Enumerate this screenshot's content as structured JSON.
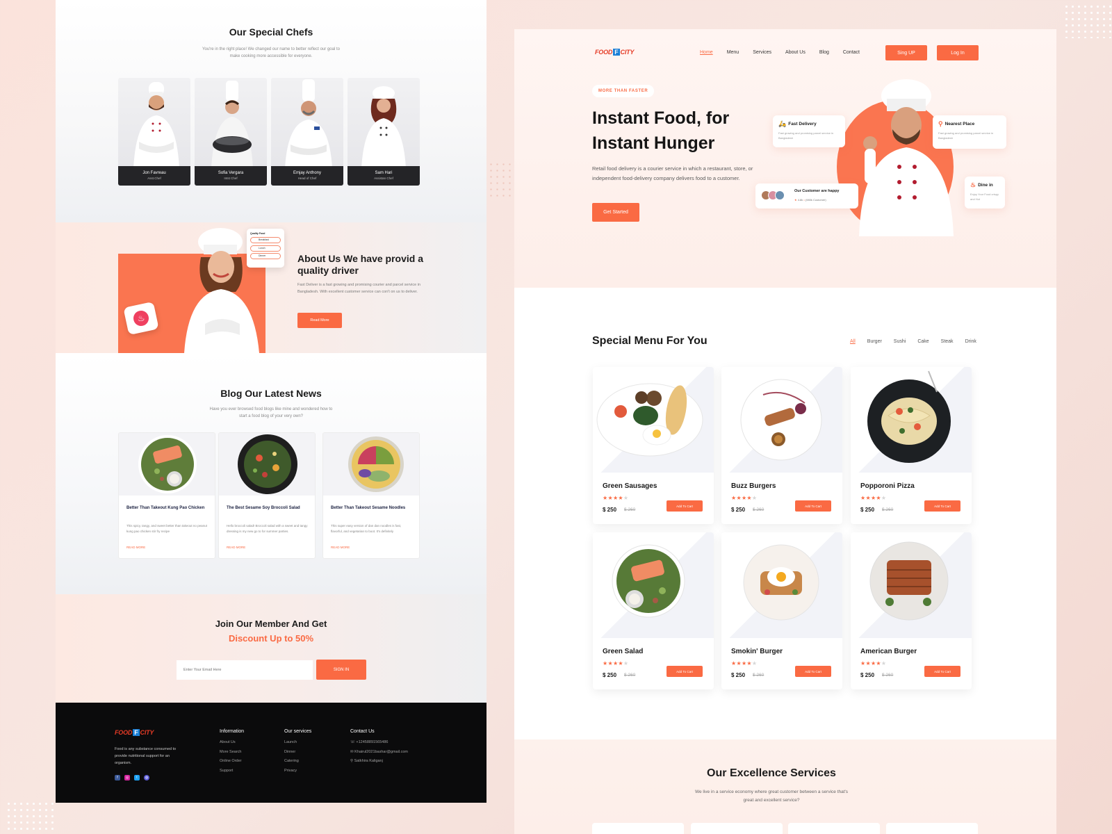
{
  "colors": {
    "accent": "#fa6a43",
    "accent_soft": "#fde9e2",
    "dark": "#0b0b0c"
  },
  "chefs": {
    "title": "Our Special Chefs",
    "subtitle": "You're in the right place! We changed our name to better reflect our goal to make cooking more accessible for everyone.",
    "items": [
      {
        "name": "Jon Favreau",
        "role": "Asst.Chef"
      },
      {
        "name": "Sofia Vergara",
        "role": "Intst Chef"
      },
      {
        "name": "Emjay Anthony",
        "role": "Head of Chef"
      },
      {
        "name": "Sam Hari",
        "role": "Assistan Chef"
      }
    ]
  },
  "about": {
    "title": "About Us We have provid a quality driver",
    "text": "Fast Deliver is a fast growing and promising courier and parcel service in Bangladesh. With excellent customer service can con't on us to deliver.",
    "button": "Read More",
    "quality_card": {
      "title": "Quality Food",
      "items": [
        "Breakfast",
        "Lunch",
        "Dinner"
      ]
    }
  },
  "blog": {
    "title": "Blog Our Latest News",
    "subtitle": "Have you ever browsed food blogs like mine and wondered how to start a food blog of your very own?",
    "posts": [
      {
        "title": "Better Than Takeout Kung Pao Chicken",
        "text": "This spicy, tangy, and sweet better than takeout no peanut kung pao chicken stir fry recipe",
        "more": "READ MORE"
      },
      {
        "title": "The Best Sesame Soy Broccoli Salad",
        "text": "Hello broccoli salad! Broccoli salad with a sweet and tangy dressing is my new go to for summer parties.",
        "more": "READ MORE"
      },
      {
        "title": "Better Than Takeout Sesame Noodles",
        "text": "This super easy version of dan dan noodles is fast, flavorful, and vegetarian to boot. It's definitely",
        "more": "READ MORE"
      }
    ]
  },
  "join": {
    "line1": "Join Our  Member And Get",
    "line2": "Discount Up to 50%",
    "placeholder": "Enter Your Email Here",
    "button": "SIGN IN"
  },
  "footer": {
    "logo_a": "FOOD",
    "logo_b": "F",
    "logo_c": "CITY",
    "about": "Food is any substance consumed to provide nutritional support for an organism.",
    "columns": [
      {
        "title": "Information",
        "links": [
          "About Us",
          "More Search",
          "Online Order",
          "Support"
        ]
      },
      {
        "title": "Our services",
        "links": [
          "Launch",
          "Dinner",
          "Catering",
          "Privacy"
        ]
      },
      {
        "title": "Contact Us",
        "links": [
          "+12458891565486",
          "Khairul2021bashar@gmail.com",
          "Satkhira Kaliganj"
        ]
      }
    ]
  },
  "nav": {
    "items": [
      "Home",
      "Menu",
      "Services",
      "About Us",
      "Blog",
      "Contact"
    ],
    "signup": "Sing UP",
    "login": "Log In"
  },
  "hero": {
    "pill": "MORE THAN FASTER",
    "title_line1": "Instant Food, for",
    "title_line2": "Instant Hunger",
    "text": "Retail food delivery is a courier service in which a restaurant, store, or independent food-delivery company delivers food to a customer.",
    "button": "Get Started",
    "cards": {
      "fast": {
        "title": "Fast Delivery",
        "text": "Fast growing and promising parcel service in Bangladesh"
      },
      "nearest": {
        "title": "Nearest Place",
        "text": "Fast growing and promising parcel service in Bangladesh"
      },
      "happy": {
        "title": "Our Customer are happy",
        "rating": "4.8k",
        "count": "(980k Customer)"
      },
      "dine": {
        "title": "Dine in",
        "text": "Enjoy Your Food crispy and Hot"
      }
    }
  },
  "menu": {
    "title": "Special Menu For You",
    "tabs": [
      "All",
      "Burger",
      "Sushi",
      "Cake",
      "Steak",
      "Drink"
    ],
    "cart_label": "Add To Cart",
    "items": [
      {
        "name": "Green Sausages",
        "price": "$ 250",
        "old_price": "$ 260",
        "rating": 4
      },
      {
        "name": "Buzz Burgers",
        "price": "$ 250",
        "old_price": "$ 260",
        "rating": 4
      },
      {
        "name": "Popporoni Pizza",
        "price": "$ 250",
        "old_price": "$ 260",
        "rating": 4
      },
      {
        "name": "Green Salad",
        "price": "$ 250",
        "old_price": "$ 260",
        "rating": 4
      },
      {
        "name": "Smokin' Burger",
        "price": "$ 250",
        "old_price": "$ 260",
        "rating": 4
      },
      {
        "name": "American Burger",
        "price": "$ 250",
        "old_price": "$ 260",
        "rating": 4
      }
    ]
  },
  "services": {
    "title": "Our Excellence Services",
    "subtitle": "We live in a service economy where great customer  between a service that's great and excellent service?"
  }
}
